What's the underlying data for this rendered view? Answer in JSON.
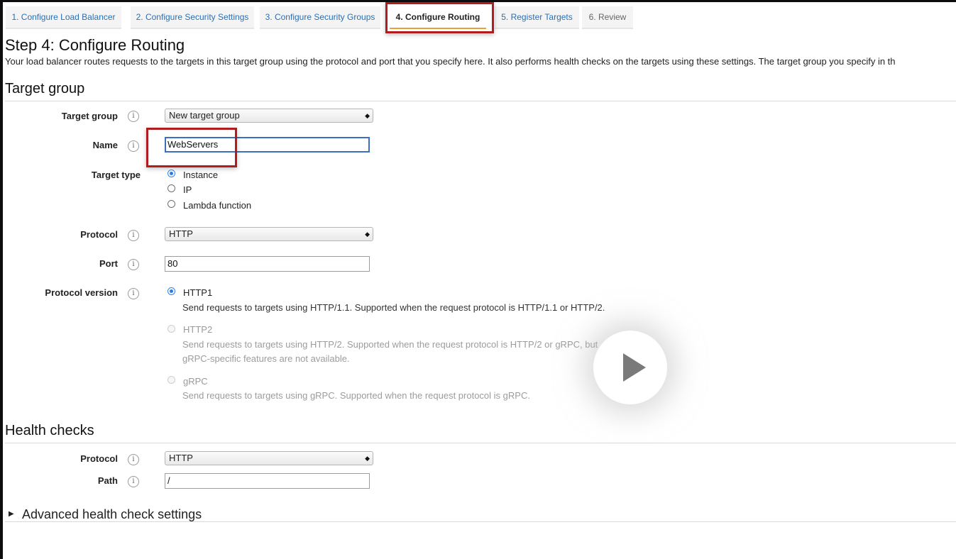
{
  "wizard": {
    "tabs": [
      {
        "label": "1. Configure Load Balancer"
      },
      {
        "label": "2. Configure Security Settings"
      },
      {
        "label": "3. Configure Security Groups"
      },
      {
        "label": "4. Configure Routing"
      },
      {
        "label": "5. Register Targets"
      },
      {
        "label": "6. Review"
      }
    ],
    "active_index": 3
  },
  "page": {
    "title": "Step 4: Configure Routing",
    "description": "Your load balancer routes requests to the targets in this target group using the protocol and port that you specify here. It also performs health checks on the targets using these settings. The target group you specify in th"
  },
  "target_group": {
    "section_title": "Target group",
    "target_group_label": "Target group",
    "target_group_value": "New target group",
    "name_label": "Name",
    "name_value": "WebServers",
    "target_type_label": "Target type",
    "target_type_options": [
      {
        "label": "Instance",
        "selected": true
      },
      {
        "label": "IP",
        "selected": false
      },
      {
        "label": "Lambda function",
        "selected": false
      }
    ],
    "protocol_label": "Protocol",
    "protocol_value": "HTTP",
    "port_label": "Port",
    "port_value": "80",
    "protocol_version_label": "Protocol version",
    "protocol_versions": [
      {
        "label": "HTTP1",
        "selected": true,
        "enabled": true,
        "description": "Send requests to targets using HTTP/1.1. Supported when the request protocol is HTTP/1.1 or HTTP/2."
      },
      {
        "label": "HTTP2",
        "selected": false,
        "enabled": false,
        "description_line1": "Send requests to targets using HTTP/2. Supported when the request protocol is HTTP/2 or gRPC, but",
        "description_line2": "gRPC-specific features are not available."
      },
      {
        "label": "gRPC",
        "selected": false,
        "enabled": false,
        "description": "Send requests to targets using gRPC. Supported when the request protocol is gRPC."
      }
    ]
  },
  "health_checks": {
    "section_title": "Health checks",
    "protocol_label": "Protocol",
    "protocol_value": "HTTP",
    "path_label": "Path",
    "path_value": "/",
    "advanced_label": "Advanced health check settings"
  },
  "icons": {
    "info": "i",
    "select_arrow": "◆",
    "caret_right": "▶"
  },
  "colors": {
    "highlight": "#b11c1f",
    "link": "#2a6fb4",
    "active_tab_underline": "#e8a13a",
    "radio_selected": "#2f7ae5"
  }
}
